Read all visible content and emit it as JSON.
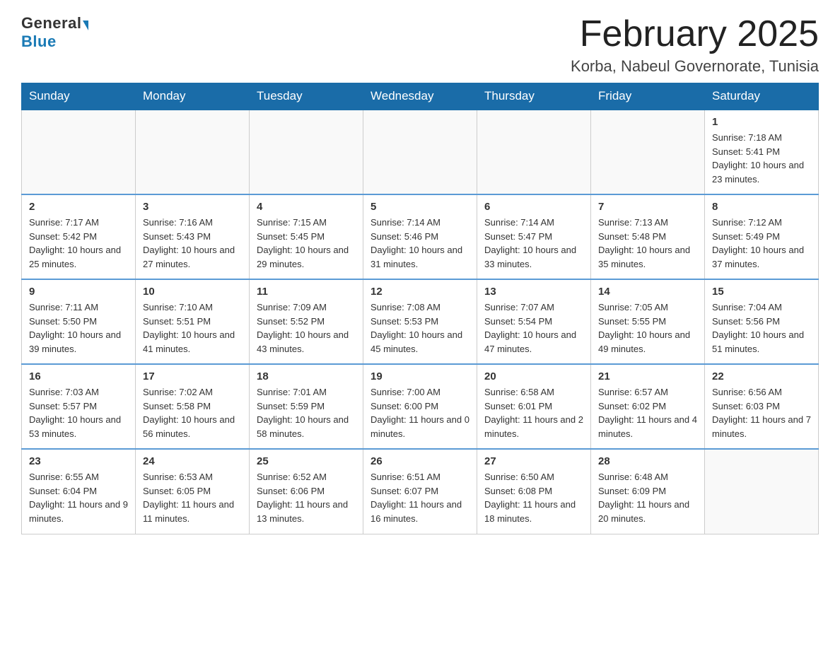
{
  "header": {
    "logo_general": "General",
    "logo_blue": "Blue",
    "month_title": "February 2025",
    "location": "Korba, Nabeul Governorate, Tunisia"
  },
  "days_of_week": [
    "Sunday",
    "Monday",
    "Tuesday",
    "Wednesday",
    "Thursday",
    "Friday",
    "Saturday"
  ],
  "weeks": [
    [
      {
        "date": "",
        "info": ""
      },
      {
        "date": "",
        "info": ""
      },
      {
        "date": "",
        "info": ""
      },
      {
        "date": "",
        "info": ""
      },
      {
        "date": "",
        "info": ""
      },
      {
        "date": "",
        "info": ""
      },
      {
        "date": "1",
        "info": "Sunrise: 7:18 AM\nSunset: 5:41 PM\nDaylight: 10 hours and 23 minutes."
      }
    ],
    [
      {
        "date": "2",
        "info": "Sunrise: 7:17 AM\nSunset: 5:42 PM\nDaylight: 10 hours and 25 minutes."
      },
      {
        "date": "3",
        "info": "Sunrise: 7:16 AM\nSunset: 5:43 PM\nDaylight: 10 hours and 27 minutes."
      },
      {
        "date": "4",
        "info": "Sunrise: 7:15 AM\nSunset: 5:45 PM\nDaylight: 10 hours and 29 minutes."
      },
      {
        "date": "5",
        "info": "Sunrise: 7:14 AM\nSunset: 5:46 PM\nDaylight: 10 hours and 31 minutes."
      },
      {
        "date": "6",
        "info": "Sunrise: 7:14 AM\nSunset: 5:47 PM\nDaylight: 10 hours and 33 minutes."
      },
      {
        "date": "7",
        "info": "Sunrise: 7:13 AM\nSunset: 5:48 PM\nDaylight: 10 hours and 35 minutes."
      },
      {
        "date": "8",
        "info": "Sunrise: 7:12 AM\nSunset: 5:49 PM\nDaylight: 10 hours and 37 minutes."
      }
    ],
    [
      {
        "date": "9",
        "info": "Sunrise: 7:11 AM\nSunset: 5:50 PM\nDaylight: 10 hours and 39 minutes."
      },
      {
        "date": "10",
        "info": "Sunrise: 7:10 AM\nSunset: 5:51 PM\nDaylight: 10 hours and 41 minutes."
      },
      {
        "date": "11",
        "info": "Sunrise: 7:09 AM\nSunset: 5:52 PM\nDaylight: 10 hours and 43 minutes."
      },
      {
        "date": "12",
        "info": "Sunrise: 7:08 AM\nSunset: 5:53 PM\nDaylight: 10 hours and 45 minutes."
      },
      {
        "date": "13",
        "info": "Sunrise: 7:07 AM\nSunset: 5:54 PM\nDaylight: 10 hours and 47 minutes."
      },
      {
        "date": "14",
        "info": "Sunrise: 7:05 AM\nSunset: 5:55 PM\nDaylight: 10 hours and 49 minutes."
      },
      {
        "date": "15",
        "info": "Sunrise: 7:04 AM\nSunset: 5:56 PM\nDaylight: 10 hours and 51 minutes."
      }
    ],
    [
      {
        "date": "16",
        "info": "Sunrise: 7:03 AM\nSunset: 5:57 PM\nDaylight: 10 hours and 53 minutes."
      },
      {
        "date": "17",
        "info": "Sunrise: 7:02 AM\nSunset: 5:58 PM\nDaylight: 10 hours and 56 minutes."
      },
      {
        "date": "18",
        "info": "Sunrise: 7:01 AM\nSunset: 5:59 PM\nDaylight: 10 hours and 58 minutes."
      },
      {
        "date": "19",
        "info": "Sunrise: 7:00 AM\nSunset: 6:00 PM\nDaylight: 11 hours and 0 minutes."
      },
      {
        "date": "20",
        "info": "Sunrise: 6:58 AM\nSunset: 6:01 PM\nDaylight: 11 hours and 2 minutes."
      },
      {
        "date": "21",
        "info": "Sunrise: 6:57 AM\nSunset: 6:02 PM\nDaylight: 11 hours and 4 minutes."
      },
      {
        "date": "22",
        "info": "Sunrise: 6:56 AM\nSunset: 6:03 PM\nDaylight: 11 hours and 7 minutes."
      }
    ],
    [
      {
        "date": "23",
        "info": "Sunrise: 6:55 AM\nSunset: 6:04 PM\nDaylight: 11 hours and 9 minutes."
      },
      {
        "date": "24",
        "info": "Sunrise: 6:53 AM\nSunset: 6:05 PM\nDaylight: 11 hours and 11 minutes."
      },
      {
        "date": "25",
        "info": "Sunrise: 6:52 AM\nSunset: 6:06 PM\nDaylight: 11 hours and 13 minutes."
      },
      {
        "date": "26",
        "info": "Sunrise: 6:51 AM\nSunset: 6:07 PM\nDaylight: 11 hours and 16 minutes."
      },
      {
        "date": "27",
        "info": "Sunrise: 6:50 AM\nSunset: 6:08 PM\nDaylight: 11 hours and 18 minutes."
      },
      {
        "date": "28",
        "info": "Sunrise: 6:48 AM\nSunset: 6:09 PM\nDaylight: 11 hours and 20 minutes."
      },
      {
        "date": "",
        "info": ""
      }
    ]
  ]
}
